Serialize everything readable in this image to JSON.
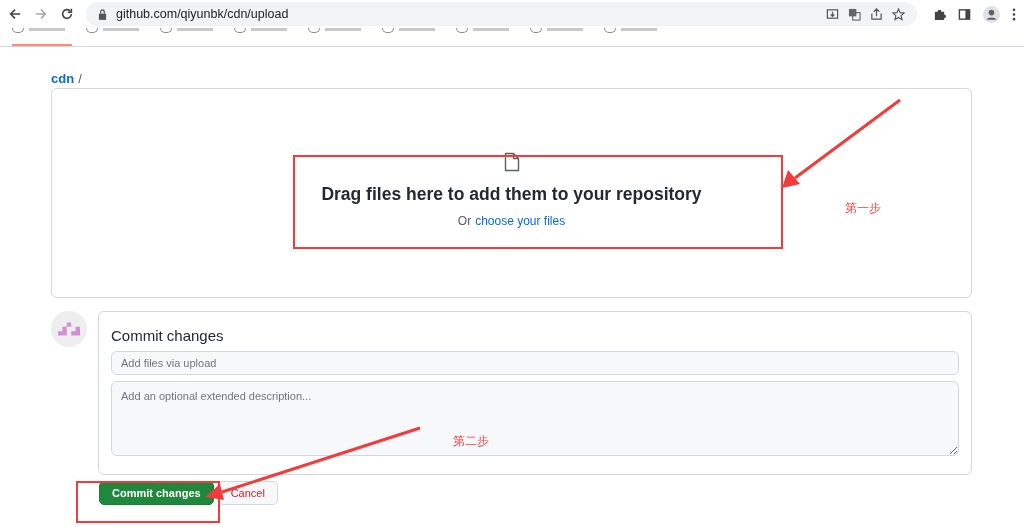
{
  "browser": {
    "url": "github.com/qiyunbk/cdn/upload"
  },
  "repo_tabs": [
    {
      "selected": true
    },
    {
      "selected": false
    },
    {
      "selected": false
    },
    {
      "selected": false
    },
    {
      "selected": false
    },
    {
      "selected": false
    },
    {
      "selected": false
    },
    {
      "selected": false
    },
    {
      "selected": false
    }
  ],
  "breadcrumb": {
    "repo": "cdn",
    "separator": "/"
  },
  "drop_zone": {
    "heading": "Drag files here to add them to your repository",
    "prefix": "Or",
    "link": "choose your files"
  },
  "commit": {
    "title": "Commit changes",
    "summary_placeholder": "Add files via upload",
    "description_placeholder": "Add an optional extended description...",
    "submit": "Commit changes",
    "cancel": "Cancel"
  },
  "annotations": [
    {
      "label": "第一步"
    },
    {
      "label": "第二步"
    }
  ]
}
